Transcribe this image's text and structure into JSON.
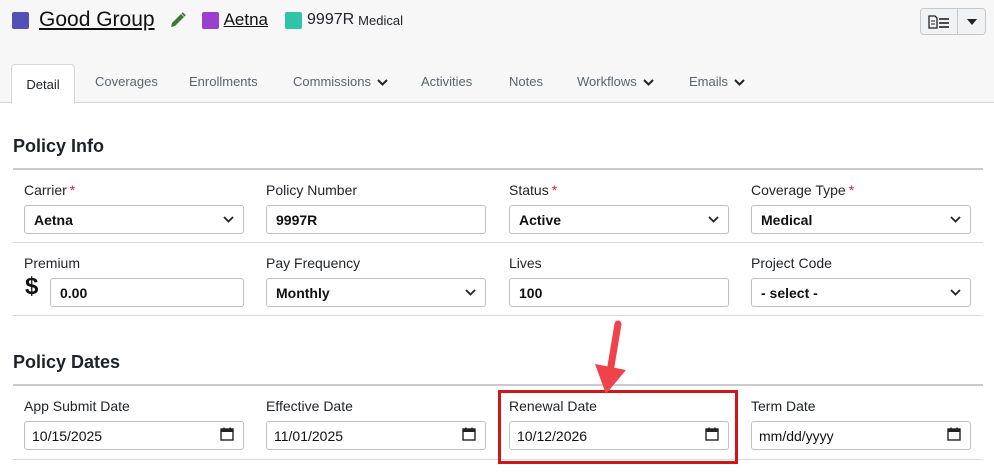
{
  "header": {
    "group_name": "Good Group",
    "carrier_name": "Aetna",
    "policy_number": "9997R",
    "policy_type": "Medical",
    "colors": {
      "group": "#5351b8",
      "carrier": "#9b3fcf",
      "policy": "#2ec4a6",
      "pencil": "#3a7a31"
    },
    "icons": [
      "edit-pencil-icon",
      "document-list-icon",
      "caret-down-icon"
    ]
  },
  "tabs": [
    {
      "label": "Detail",
      "active": true
    },
    {
      "label": "Coverages"
    },
    {
      "label": "Enrollments"
    },
    {
      "label": "Commissions",
      "dropdown": true
    },
    {
      "label": "Activities"
    },
    {
      "label": "Notes"
    },
    {
      "label": "Workflows",
      "dropdown": true
    },
    {
      "label": "Emails",
      "dropdown": true
    }
  ],
  "policy_info": {
    "title": "Policy Info",
    "carrier": {
      "label": "Carrier",
      "required": "*",
      "value": "Aetna"
    },
    "policy_number": {
      "label": "Policy Number",
      "value": "9997R"
    },
    "status": {
      "label": "Status",
      "required": "*",
      "value": "Active"
    },
    "coverage_type": {
      "label": "Coverage Type",
      "required": "*",
      "value": "Medical"
    },
    "premium": {
      "label": "Premium",
      "currency": "$",
      "value": "0.00"
    },
    "pay_frequency": {
      "label": "Pay Frequency",
      "value": "Monthly"
    },
    "lives": {
      "label": "Lives",
      "value": "100"
    },
    "project_code": {
      "label": "Project Code",
      "value": "- select -"
    }
  },
  "policy_dates": {
    "title": "Policy Dates",
    "app_submit": {
      "label": "App Submit Date",
      "value": "10/15/2025"
    },
    "effective": {
      "label": "Effective Date",
      "value": "11/01/2025"
    },
    "renewal": {
      "label": "Renewal Date",
      "value": "10/12/2026"
    },
    "term": {
      "label": "Term Date",
      "placeholder": "mm/dd/yyyy"
    }
  },
  "annotation": {
    "color": "#d01717",
    "arrow_color": "#f0424a"
  }
}
